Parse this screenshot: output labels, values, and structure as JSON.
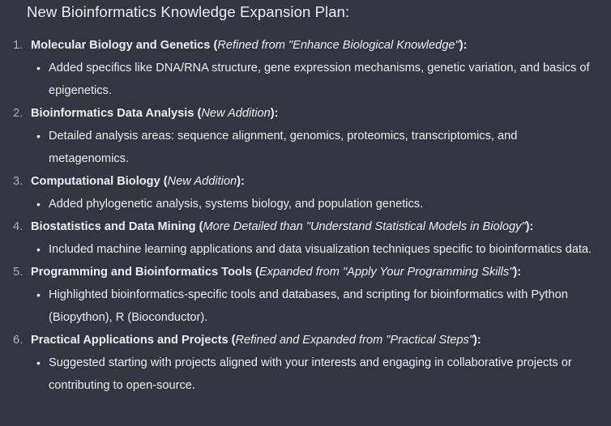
{
  "heading": "New Bioinformatics Knowledge Expansion Plan:",
  "items": [
    {
      "number": "1.",
      "title": "Molecular Biology and Genetics",
      "note": "Refined from \"Enhance Biological Knowledge\"",
      "detail": "Added specifics like DNA/RNA structure, gene expression mechanisms, genetic variation, and basics of epigenetics."
    },
    {
      "number": "2.",
      "title": "Bioinformatics Data Analysis",
      "note": "New Addition",
      "detail": "Detailed analysis areas: sequence alignment, genomics, proteomics, transcriptomics, and metagenomics."
    },
    {
      "number": "3.",
      "title": "Computational Biology",
      "note": "New Addition",
      "detail": "Added phylogenetic analysis, systems biology, and population genetics."
    },
    {
      "number": "4.",
      "title": "Biostatistics and Data Mining",
      "note": "More Detailed than \"Understand Statistical Models in Biology\"",
      "detail": "Included machine learning applications and data visualization techniques specific to bioinformatics data."
    },
    {
      "number": "5.",
      "title": "Programming and Bioinformatics Tools",
      "note": "Expanded from \"Apply Your Programming Skills\"",
      "detail": "Highlighted bioinformatics-specific tools and databases, and scripting for bioinformatics with Python (Biopython), R (Bioconductor)."
    },
    {
      "number": "6.",
      "title": "Practical Applications and Projects",
      "note": "Refined and Expanded from \"Practical Steps\"",
      "detail": "Suggested starting with projects aligned with your interests and engaging in collaborative projects or contributing to open-source."
    }
  ],
  "colors": {
    "background": "#343541",
    "text": "#ececf1",
    "number": "#acacbe"
  }
}
